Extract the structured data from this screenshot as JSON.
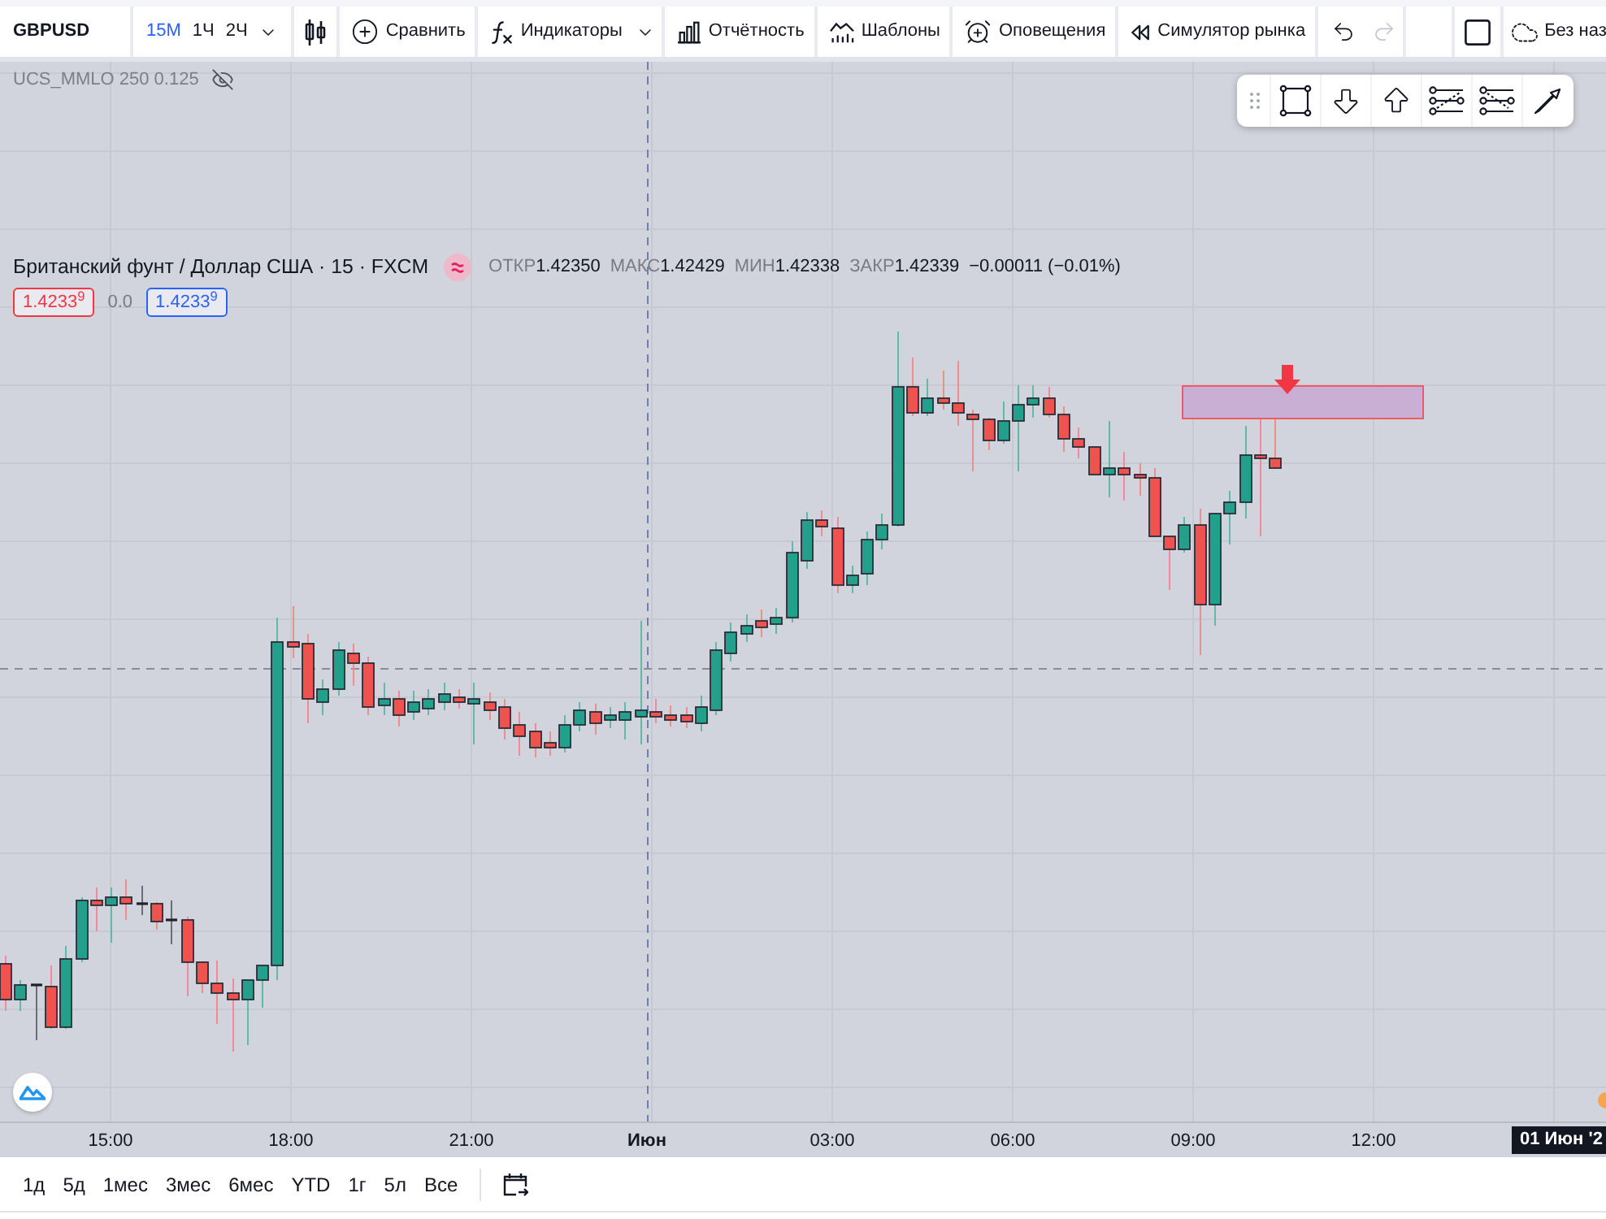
{
  "toolbar": {
    "symbol": "GBPUSD",
    "intervals": [
      {
        "label": "15M",
        "selected": true
      },
      {
        "label": "1Ч",
        "selected": false
      },
      {
        "label": "2Ч",
        "selected": false
      }
    ],
    "buttons": [
      {
        "kind": "compare",
        "label": "Сравнить",
        "menu": false
      },
      {
        "kind": "indicators",
        "label": "Индикаторы",
        "menu": true
      },
      {
        "kind": "reports",
        "label": "Отчётность",
        "menu": false
      },
      {
        "kind": "templates",
        "label": "Шаблоны",
        "menu": false
      },
      {
        "kind": "alerts",
        "label": "Оповещения",
        "menu": false
      },
      {
        "kind": "replay",
        "label": "Симулятор рынка",
        "menu": false
      }
    ],
    "undo": {
      "disabled": false
    },
    "redo": {
      "disabled": true
    },
    "layout_name": "Без наз"
  },
  "legend": {
    "indicator": {
      "name": "UCS_MMLO 250 0.125",
      "hidden": true
    },
    "series": {
      "title": "Британский фунт / Доллар США · 15 · FXCM",
      "ohlc": [
        {
          "label": "ОТКР",
          "value": "1.42350"
        },
        {
          "label": "МАКС",
          "value": "1.42429"
        },
        {
          "label": "МИН",
          "value": "1.42338"
        },
        {
          "label": "ЗАКР",
          "value": "1.42339"
        }
      ],
      "change": "−0.00011 (−0.01%)",
      "sell_price": "1.4233$^{9}$",
      "spread": "0.0",
      "buy_price": "1.4233$^{9}$"
    }
  },
  "time_axis": {
    "labels": [
      {
        "label": "15:00",
        "bold": false
      },
      {
        "label": "18:00",
        "bold": false
      },
      {
        "label": "21:00",
        "bold": false
      },
      {
        "label": "Июн",
        "bold": true
      },
      {
        "label": "03:00",
        "bold": false
      },
      {
        "label": "06:00",
        "bold": false
      },
      {
        "label": "09:00",
        "bold": false
      },
      {
        "label": "12:00",
        "bold": false
      }
    ],
    "crosshair_label": "01 Июн '2"
  },
  "ranges": [
    "1д",
    "5д",
    "1мес",
    "3мес",
    "6мес",
    "YTD",
    "1г",
    "5л",
    "Все"
  ]
}
